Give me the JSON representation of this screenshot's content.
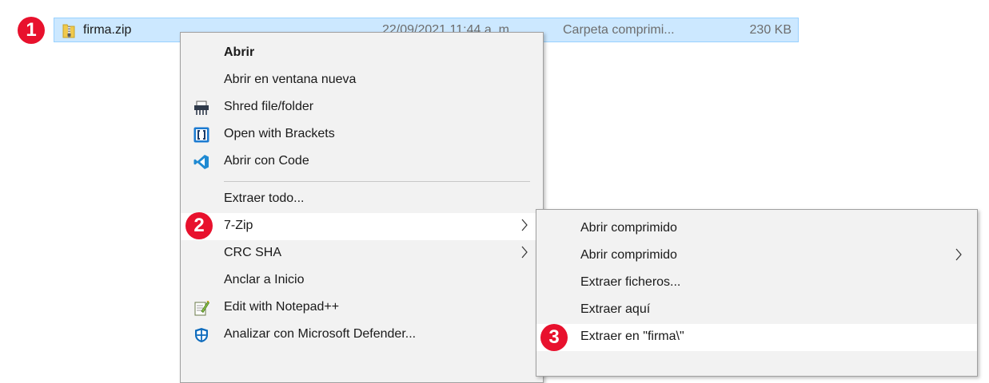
{
  "file": {
    "name": "firma.zip",
    "date": "22/09/2021 11:44 a. m.",
    "type": "Carpeta comprimi...",
    "size": "230 KB"
  },
  "steps": [
    "1",
    "2",
    "3"
  ],
  "context_menu": {
    "items": [
      {
        "label": "Abrir",
        "bold": true
      },
      {
        "label": "Abrir en ventana nueva"
      },
      {
        "label": "Shred file/folder",
        "icon": "shredder-icon"
      },
      {
        "label": "Open with Brackets",
        "icon": "brackets-icon"
      },
      {
        "label": "Abrir con Code",
        "icon": "vscode-icon"
      },
      {
        "label": "Extraer todo..."
      },
      {
        "label": "7-Zip",
        "submenu": true,
        "highlighted": true
      },
      {
        "label": "CRC SHA",
        "submenu": true
      },
      {
        "label": "Anclar a Inicio"
      },
      {
        "label": "Edit with Notepad++",
        "icon": "notepadpp-icon"
      },
      {
        "label": "Analizar con Microsoft Defender...",
        "icon": "defender-icon"
      }
    ]
  },
  "submenu_7zip": {
    "items": [
      {
        "label": "Abrir comprimido"
      },
      {
        "label": "Abrir comprimido",
        "submenu": true
      },
      {
        "label": "Extraer ficheros..."
      },
      {
        "label": "Extraer aquí"
      },
      {
        "label": "Extraer en \"firma\\\"",
        "highlighted": true
      }
    ]
  },
  "colors": {
    "selection_bg": "#cce8ff",
    "badge_red": "#e8112d",
    "menu_bg": "#f2f2f2",
    "highlight_bg": "#ffffff"
  }
}
